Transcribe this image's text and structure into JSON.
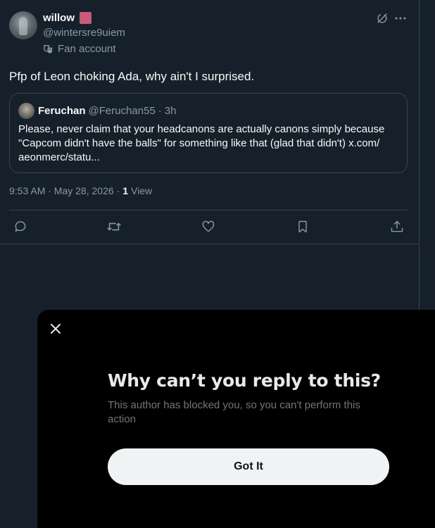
{
  "post": {
    "author_name": "willow",
    "author_handle": "@wintersre9uiem",
    "fan_label": "Fan account",
    "text": "Pfp of Leon choking Ada, why ain't I surprised.",
    "quote": {
      "name": "Feruchan",
      "handle": "@Feruchan55",
      "separator": "·",
      "time": "3h",
      "text": "Please, never claim that your headcanons are actually canons simply because \"Capcom didn't have the balls\" for something like that (glad that didn't) x.com/ aeonmerc/statu..."
    },
    "timestamp": "9:53 AM · May 28, 2026 ·",
    "views_count": "1",
    "views_label": "View"
  },
  "icons": {
    "grok": "grok-icon",
    "more": "more-icon",
    "reply": "reply-icon",
    "repost": "repost-icon",
    "like": "like-icon",
    "bookmark": "bookmark-icon",
    "share": "share-icon",
    "close": "close-icon",
    "fan": "theater-masks-icon"
  },
  "sheet": {
    "title": "Why can’t you reply to this?",
    "description": "This author has blocked you, so you can't perform this action",
    "button_label": "Got It"
  },
  "colors": {
    "background": "#15202b",
    "border": "#38444d",
    "muted": "#8b98a5",
    "sheet_bg": "#000000",
    "button_bg": "#eff3f4"
  }
}
